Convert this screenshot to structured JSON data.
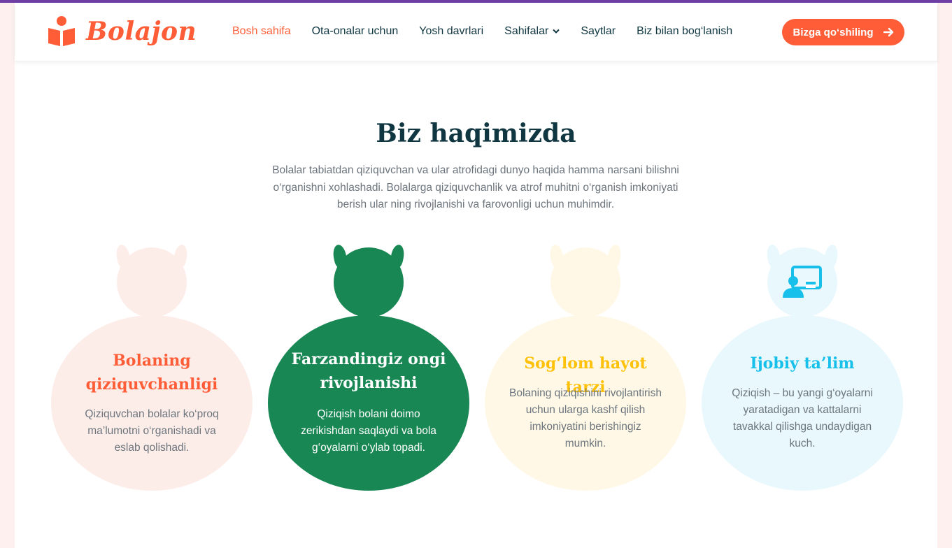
{
  "brand": {
    "name": "Bolajon",
    "icon": "book-reader-icon"
  },
  "nav": {
    "items": [
      {
        "label": "Bosh sahifa",
        "active": true
      },
      {
        "label": "Ota-onalar uchun",
        "active": false
      },
      {
        "label": "Yosh davrlari",
        "active": false
      },
      {
        "label": "Sahifalar",
        "active": false,
        "dropdown": true
      },
      {
        "label": "Saytlar",
        "active": false
      },
      {
        "label": "Biz bilan bog‘lanish",
        "active": false
      }
    ],
    "cta_label": "Bizga qo‘shiling"
  },
  "about": {
    "title": "Biz haqimizda",
    "description": "Bolalar tabiatdan qiziquvchan va ular atrofidagi dunyo haqida hamma narsani bilishni o‘rganishni xohlashadi. Bolalarga qiziquvchanlik va atrof muhitni o‘rganish imkoniyati berish ular ning rivojlanishi va farovonligi uchun muhimdir."
  },
  "cards": [
    {
      "title": "Bolaning qiziquvchanligi",
      "text": "Qiziquvchan bolalar ko‘proq ma’lumotni o‘rganishadi va eslab qolishadi.",
      "color": "#fe5d37"
    },
    {
      "title": "Farzandingiz ongi rivojlanishi",
      "text": "Qiziqish bolani doimo zerikishdan saqlaydi va bola g‘oyalarni o‘ylab topadi.",
      "color": "#198754"
    },
    {
      "title": "Sog‘lom hayot tarzi",
      "text": "Bolaning qiziqishini rivojlantirish uchun ularga kashf qilish imkoniyatini berishingiz mumkin.",
      "color": "#ffc107"
    },
    {
      "title": "Ijobiy ta’lim",
      "text": "Qiziqish – bu yangi g‘oyalarni yaratadigan va kattalarni tavakkal qilishga undaydigan kuch.",
      "color": "#17c0eb",
      "icon": "online-teacher-icon"
    }
  ],
  "colors": {
    "accent": "#fe5d37",
    "dark": "#103741",
    "topbar": "#6f3fa6"
  }
}
